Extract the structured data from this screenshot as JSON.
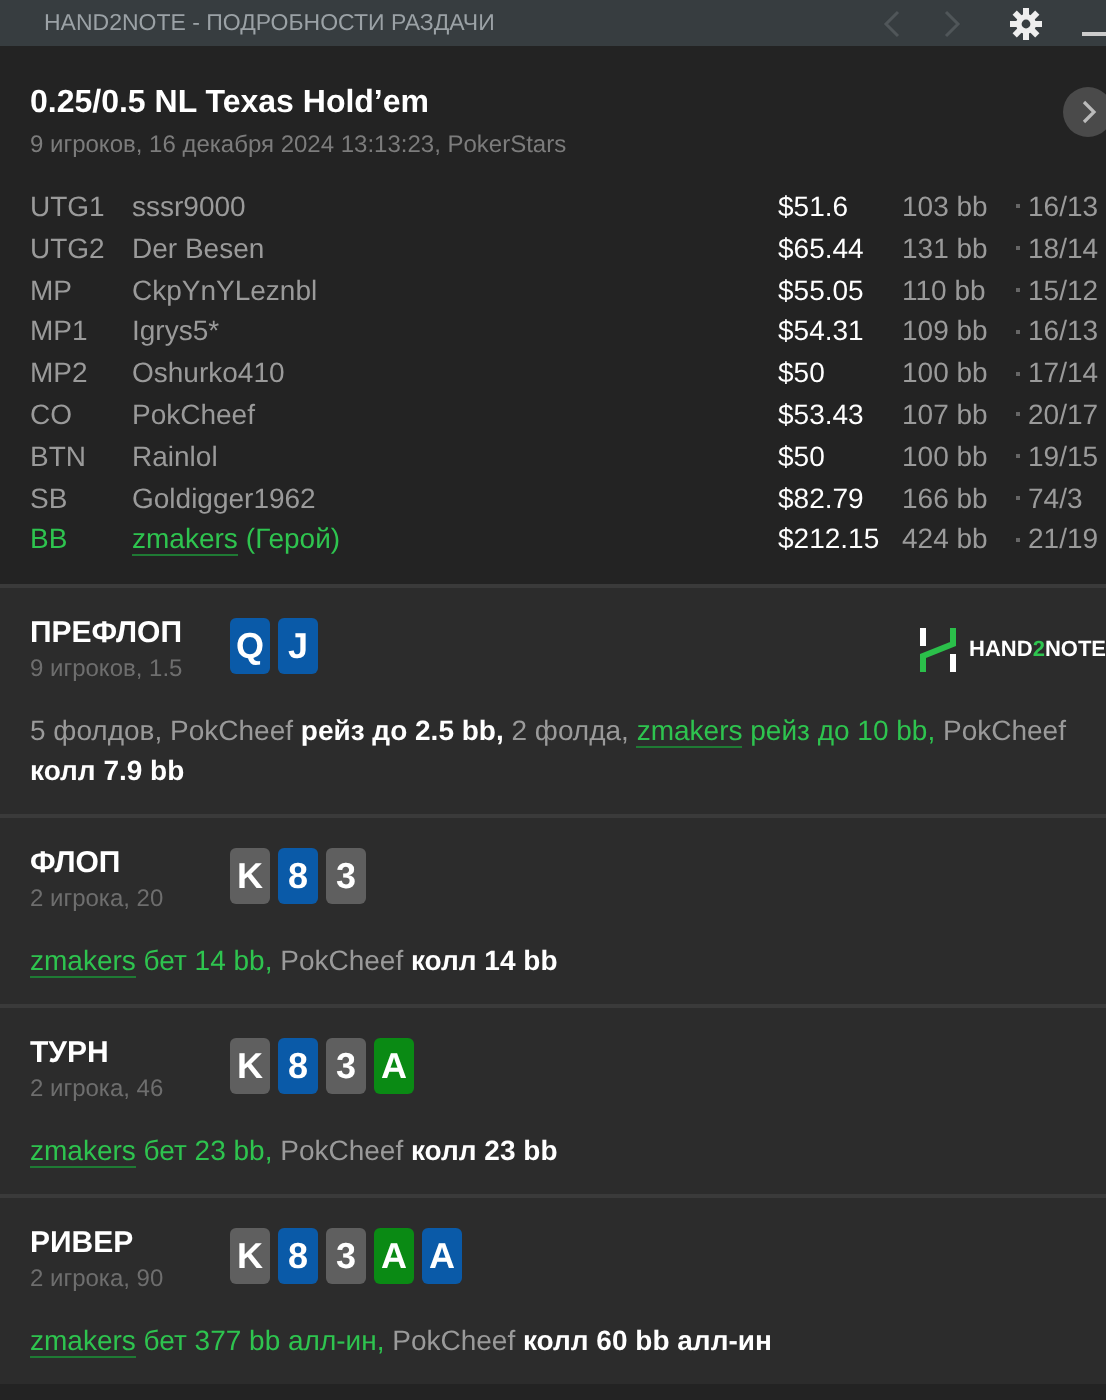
{
  "window": {
    "title": "HAND2NOTE - ПОДРОБНОСТИ РАЗДАЧИ",
    "nav_back_disabled": true,
    "nav_forward_disabled": true
  },
  "hand": {
    "title": "0.25/0.5 NL Texas Hold’em",
    "subtitle": "9 игроков, 16 декабря 2024 13:13:23, PokerStars"
  },
  "players": [
    {
      "position": "UTG1",
      "name": "sssr9000",
      "hero": false,
      "stack": "$51.6",
      "bb": "103 bb",
      "stat": "16/13"
    },
    {
      "position": "UTG2",
      "name": "Der Besen",
      "hero": false,
      "stack": "$65.44",
      "bb": "131 bb",
      "stat": "18/14"
    },
    {
      "position": "MP",
      "name": "CkpYnYLeznbl",
      "hero": false,
      "stack": "$55.05",
      "bb": "110 bb",
      "stat": "15/12"
    },
    {
      "position": "MP1",
      "name": "Igrys5*",
      "hero": false,
      "stack": "$54.31",
      "bb": "109 bb",
      "stat": "16/13"
    },
    {
      "position": "MP2",
      "name": "Oshurko410",
      "hero": false,
      "stack": "$50",
      "bb": "100 bb",
      "stat": "17/14"
    },
    {
      "position": "CO",
      "name": "PokCheef",
      "hero": false,
      "stack": "$53.43",
      "bb": "107 bb",
      "stat": "20/17"
    },
    {
      "position": "BTN",
      "name": "Rainlol",
      "hero": false,
      "stack": "$50",
      "bb": "100 bb",
      "stat": "19/15"
    },
    {
      "position": "SB",
      "name": "Goldigger1962",
      "hero": false,
      "stack": "$82.79",
      "bb": "166 bb",
      "stat": "74/3"
    },
    {
      "position": "BB",
      "name": "zmakers",
      "hero": true,
      "hero_label": "(Герой)",
      "stack": "$212.15",
      "bb": "424 bb",
      "stat": "21/19"
    }
  ],
  "logo": {
    "parts": [
      "HAND",
      "2",
      "NOTE"
    ]
  },
  "streets": [
    {
      "name": "ПРЕФЛОП",
      "info": "9 игроков, 1.5",
      "show_logo": true,
      "cards": [
        {
          "rank": "Q",
          "color": "#0a5aa8"
        },
        {
          "rank": "J",
          "color": "#0a5aa8"
        }
      ],
      "actions": [
        {
          "kind": "player",
          "text": "5 фолдов, PokCheef"
        },
        {
          "kind": "action",
          "text": "рейз до 2.5 bb,"
        },
        {
          "kind": "player",
          "text": "2 фолда,"
        },
        {
          "kind": "hero_name",
          "text": "zmakers"
        },
        {
          "kind": "hero_action",
          "text": "рейз до 10 bb,"
        },
        {
          "kind": "player",
          "text": "PokCheef"
        },
        {
          "kind": "action",
          "text": "колл 7.9 bb"
        }
      ]
    },
    {
      "name": "ФЛОП",
      "info": "2 игрока, 20",
      "show_logo": false,
      "cards": [
        {
          "rank": "K",
          "color": "#5f5f5f"
        },
        {
          "rank": "8",
          "color": "#0a5aa8"
        },
        {
          "rank": "3",
          "color": "#5f5f5f"
        }
      ],
      "actions": [
        {
          "kind": "hero_name",
          "text": "zmakers"
        },
        {
          "kind": "hero_action",
          "text": "бет 14 bb,"
        },
        {
          "kind": "player",
          "text": "PokCheef"
        },
        {
          "kind": "action",
          "text": "колл 14 bb"
        }
      ]
    },
    {
      "name": "ТУРН",
      "info": "2 игрока, 46",
      "show_logo": false,
      "cards": [
        {
          "rank": "K",
          "color": "#5f5f5f"
        },
        {
          "rank": "8",
          "color": "#0a5aa8"
        },
        {
          "rank": "3",
          "color": "#5f5f5f"
        },
        {
          "rank": "A",
          "color": "#0a8a14"
        }
      ],
      "actions": [
        {
          "kind": "hero_name",
          "text": "zmakers"
        },
        {
          "kind": "hero_action",
          "text": "бет 23 bb,"
        },
        {
          "kind": "player",
          "text": "PokCheef"
        },
        {
          "kind": "action",
          "text": "колл 23 bb"
        }
      ]
    },
    {
      "name": "РИВЕР",
      "info": "2 игрока, 90",
      "show_logo": false,
      "cards": [
        {
          "rank": "K",
          "color": "#5f5f5f"
        },
        {
          "rank": "8",
          "color": "#0a5aa8"
        },
        {
          "rank": "3",
          "color": "#5f5f5f"
        },
        {
          "rank": "A",
          "color": "#0a8a14"
        },
        {
          "rank": "A",
          "color": "#0a5aa8"
        }
      ],
      "actions": [
        {
          "kind": "hero_name",
          "text": "zmakers"
        },
        {
          "kind": "hero_action",
          "text": "бет 377 bb алл-ин,"
        },
        {
          "kind": "player",
          "text": "PokCheef"
        },
        {
          "kind": "action",
          "text": "колл 60 bb алл-ин"
        }
      ]
    }
  ]
}
